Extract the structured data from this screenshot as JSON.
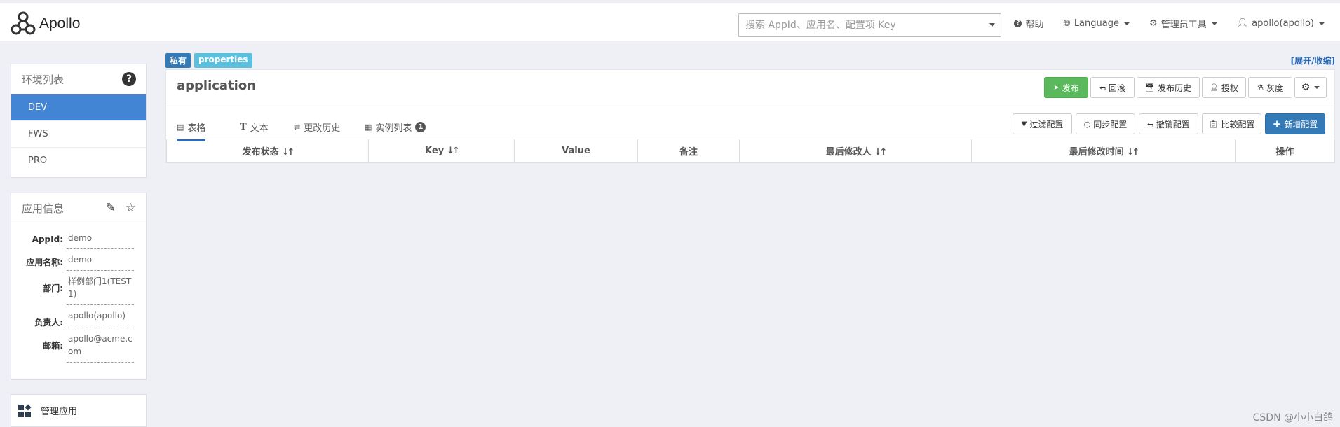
{
  "brand": {
    "name": "Apollo"
  },
  "search": {
    "placeholder": "搜索 AppId、应用名、配置项 Key"
  },
  "nav": {
    "help": "帮助",
    "language": "Language",
    "admin_tools": "管理员工具",
    "user": "apollo(apollo)"
  },
  "env_panel": {
    "title": "环境列表",
    "items": [
      "DEV",
      "FWS",
      "PRO"
    ],
    "active": "DEV"
  },
  "app_info": {
    "title": "应用信息",
    "rows": [
      {
        "label": "AppId:",
        "value": "demo"
      },
      {
        "label": "应用名称:",
        "value": "demo"
      },
      {
        "label": "部门:",
        "value": "样例部门1(TEST1)"
      },
      {
        "label": "负责人:",
        "value": "apollo(apollo)"
      },
      {
        "label": "邮箱:",
        "value": "apollo@acme.com"
      }
    ]
  },
  "manage_app": {
    "label": "管理应用"
  },
  "namespace": {
    "badge_private": "私有",
    "badge_format": "properties",
    "expand_collapse": "[展开/收缩]",
    "name": "application",
    "actions": {
      "publish": "发布",
      "rollback": "回滚",
      "history": "发布历史",
      "grant": "授权",
      "gray": "灰度"
    },
    "tabs": {
      "table": "表格",
      "text": "文本",
      "change_history": "更改历史",
      "instances": "实例列表",
      "instance_count": "1"
    },
    "toolbar": {
      "filter": "过滤配置",
      "sync": "同步配置",
      "revoke": "撤销配置",
      "compare": "比较配置",
      "add": "新增配置"
    },
    "columns": [
      "发布状态",
      "Key",
      "Value",
      "备注",
      "最后修改人",
      "最后修改时间",
      "操作"
    ]
  },
  "watermark": "CSDN @小小白鸽",
  "colors": {
    "primary": "#337ab7",
    "active_env": "#4285d4",
    "publish": "#5cb85c",
    "badge_private": "#337ab7",
    "badge_format": "#5bc0de"
  }
}
